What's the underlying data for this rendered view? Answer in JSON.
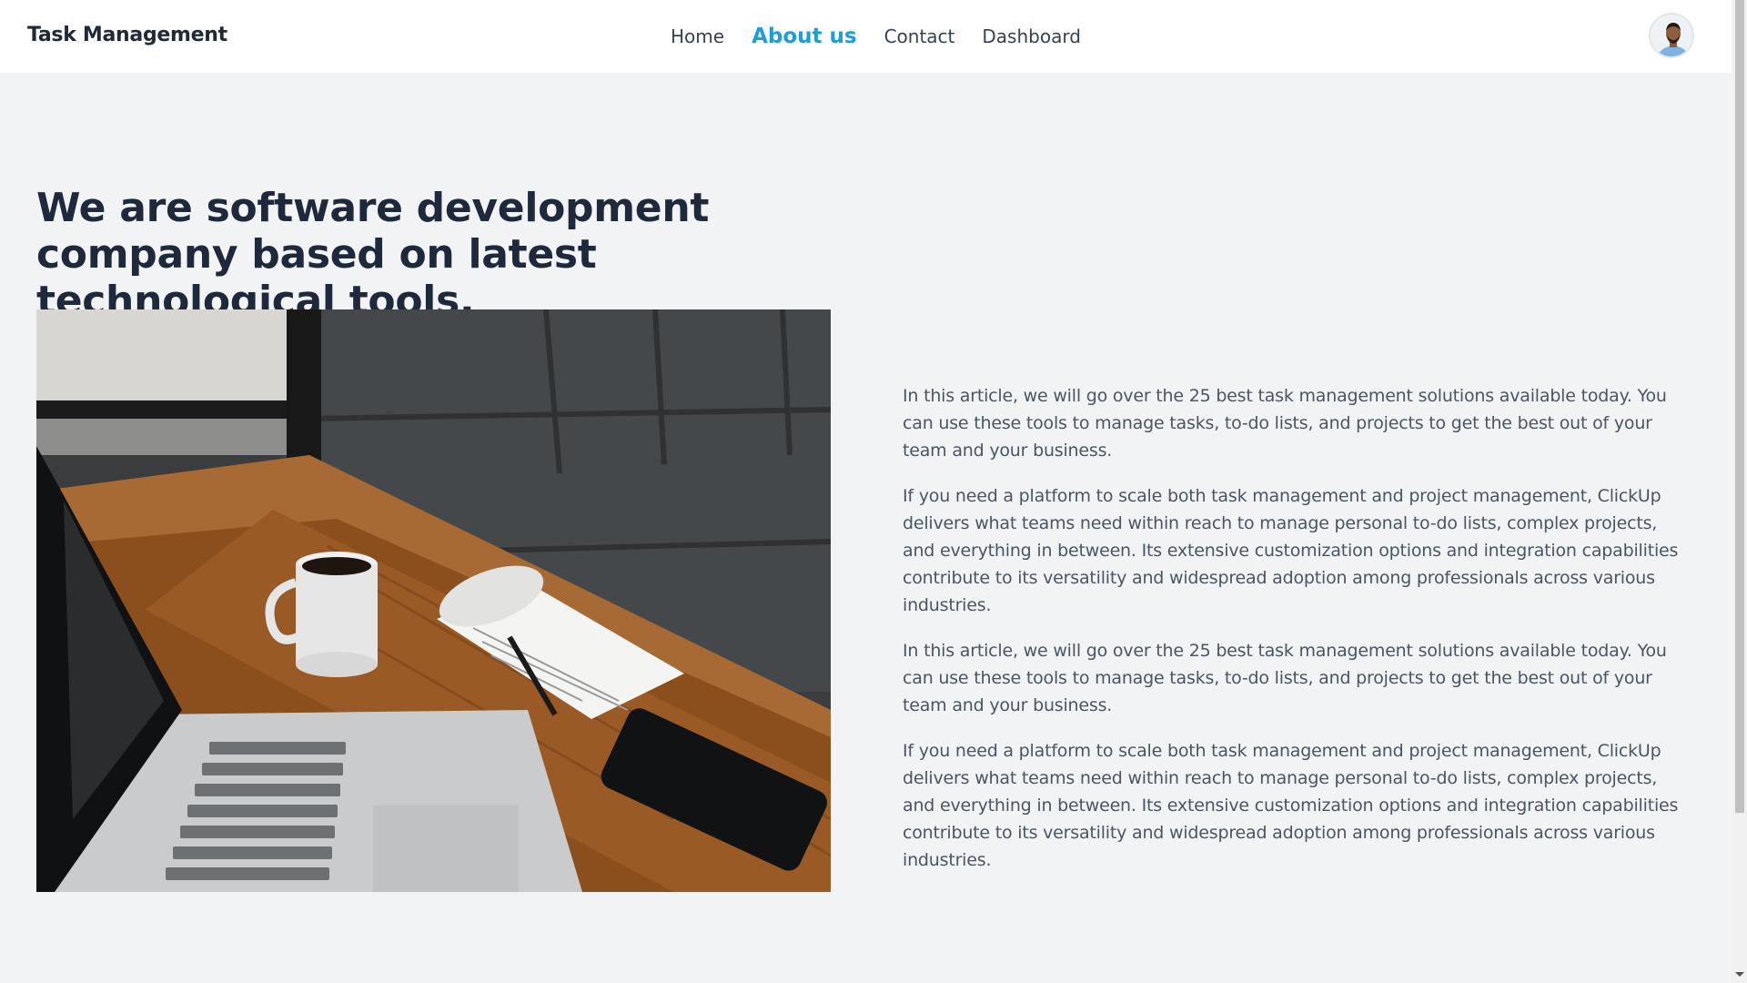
{
  "navbar": {
    "brand": "Task Management",
    "links": [
      {
        "label": "Home",
        "active": false
      },
      {
        "label": "About us",
        "active": true
      },
      {
        "label": "Contact",
        "active": false
      },
      {
        "label": "Dashboard",
        "active": false
      }
    ],
    "avatar_icon": "user-avatar"
  },
  "main": {
    "headline": "We are software development company based on latest technological tools.",
    "image_icon": "desk-workspace-photo",
    "paragraphs": [
      "In this article, we will go over the 25 best task management solutions available today. You can use these tools to manage tasks, to-do lists, and projects to get the best out of your team and your business.",
      "If you need a platform to scale both task management and project management, ClickUp delivers what teams need within reach to manage personal to-do lists, complex projects, and everything in between. Its extensive customization options and integration capabilities contribute to its versatility and widespread adoption among professionals across various industries.",
      "In this article, we will go over the 25 best task management solutions available today. You can use these tools to manage tasks, to-do lists, and projects to get the best out of your team and your business.",
      "If you need a platform to scale both task management and project management, ClickUp delivers what teams need within reach to manage personal to-do lists, complex projects, and everything in between. Its extensive customization options and integration capabilities contribute to its versatility and widespread adoption among professionals across various industries."
    ]
  },
  "colors": {
    "accent": "#1a9fd9",
    "background": "#f2f3f5",
    "navbar": "#ffffff",
    "heading": "#1e293b",
    "body_text": "#4b5563"
  }
}
